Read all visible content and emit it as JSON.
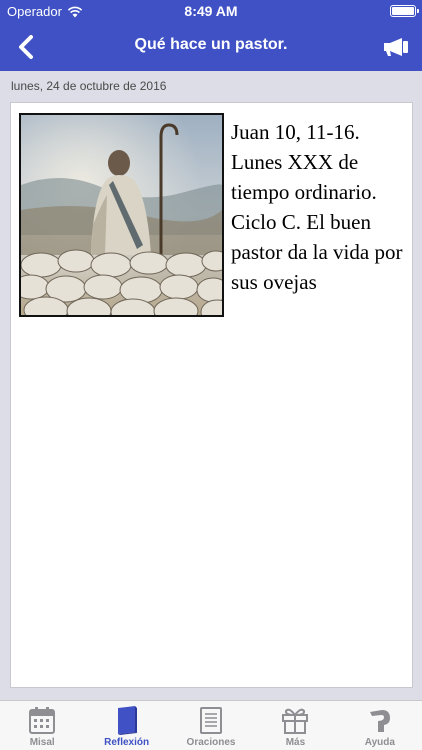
{
  "status_bar": {
    "carrier": "Operador",
    "time": "8:49 AM"
  },
  "nav": {
    "title": "Qué hace un pastor."
  },
  "date": "lunes, 24 de octubre de 2016",
  "article": {
    "title": "Juan 10, 11-16. Lunes XXX de tiempo ordinario. Ciclo C. El buen pastor da la vida por sus ovejas"
  },
  "tabs": [
    {
      "label": "Misal",
      "icon": "calendar-icon"
    },
    {
      "label": "Reflexión",
      "icon": "book-icon"
    },
    {
      "label": "Oraciones",
      "icon": "notepad-icon"
    },
    {
      "label": "Más",
      "icon": "gift-icon"
    },
    {
      "label": "Ayuda",
      "icon": "help-icon"
    }
  ],
  "colors": {
    "brand": "#3f51c4",
    "inactive_tab": "#8e8e93",
    "background": "#dcdde6"
  }
}
